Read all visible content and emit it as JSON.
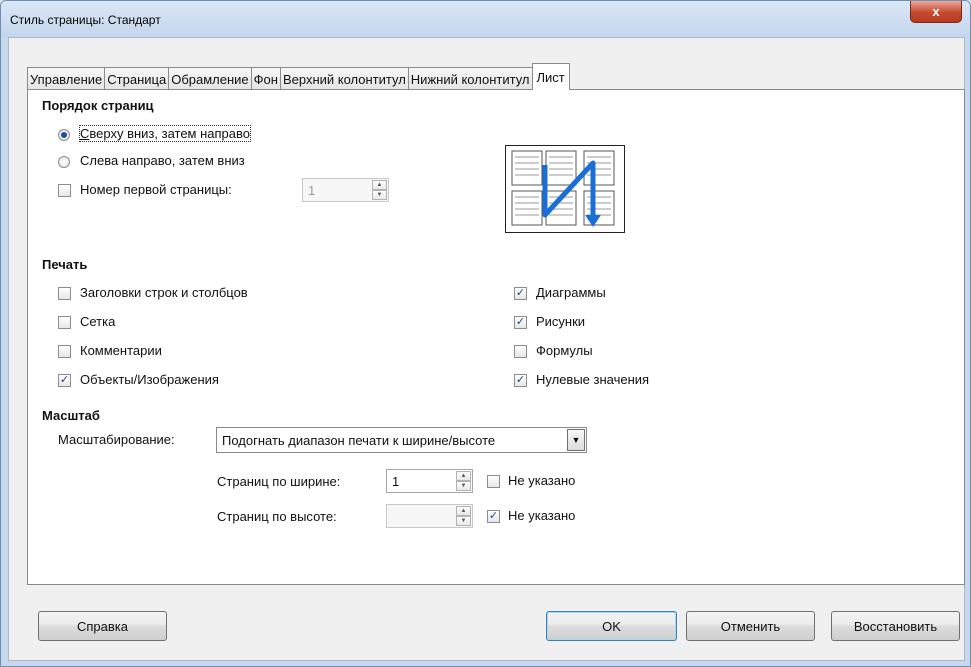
{
  "window": {
    "title": "Стиль страницы: Стандарт",
    "close_symbol": "x"
  },
  "tabs": [
    {
      "label": "Управление",
      "active": false
    },
    {
      "label": "Страница",
      "active": false
    },
    {
      "label": "Обрамление",
      "active": false
    },
    {
      "label": "Фон",
      "active": false
    },
    {
      "label": "Верхний колонтитул",
      "active": false
    },
    {
      "label": "Нижний колонтитул",
      "active": false
    },
    {
      "label": "Лист",
      "active": true
    }
  ],
  "page_order": {
    "title": "Порядок страниц",
    "top_down": {
      "label": "Сверху вниз, затем направо",
      "selected": true
    },
    "left_right": {
      "label": "Слева направо, затем вниз",
      "selected": false
    },
    "first_page": {
      "label": "Номер первой страницы:",
      "checked": false,
      "value": "1"
    },
    "preview_icon": "page-order-zigzag-icon"
  },
  "print": {
    "title": "Печать",
    "headers": {
      "label": "Заголовки строк и столбцов",
      "checked": false
    },
    "grid": {
      "label": "Сетка",
      "checked": false
    },
    "comments": {
      "label": "Комментарии",
      "checked": false
    },
    "objects": {
      "label": "Объекты/Изображения",
      "checked": true
    },
    "charts": {
      "label": "Диаграммы",
      "checked": true
    },
    "drawings": {
      "label": "Рисунки",
      "checked": true
    },
    "formulas": {
      "label": "Формулы",
      "checked": false
    },
    "zero_values": {
      "label": "Нулевые значения",
      "checked": true
    }
  },
  "scale": {
    "title": "Масштаб",
    "mode_label": "Масштабирование:",
    "mode_value": "Подогнать диапазон печати к ширине/высоте",
    "width_label": "Страниц по ширине:",
    "width_value": "1",
    "width_unspecified": {
      "label": "Не указано",
      "checked": false
    },
    "height_label": "Страниц по высоте:",
    "height_value": "",
    "height_unspecified": {
      "label": "Не указано",
      "checked": true
    }
  },
  "buttons": {
    "help": "Справка",
    "ok": "OK",
    "cancel": "Отменить",
    "reset": "Восстановить"
  },
  "colors": {
    "accent": "#1c4ea8",
    "zigzag_arrow": "#1a6fd6"
  }
}
